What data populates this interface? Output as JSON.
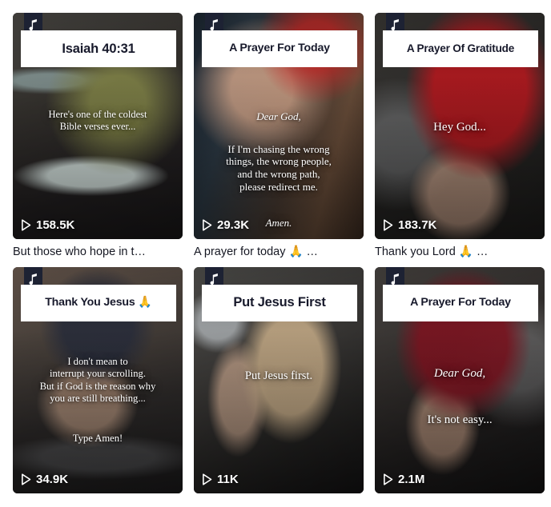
{
  "feed": {
    "videos": [
      {
        "id": "video-1",
        "music_icon": "music-note-icon",
        "title": "Isaiah 40:31",
        "overlay_text": "Here's one of the coldest\nBible verses ever...",
        "play_icon": "play-icon",
        "play_count": "158.5K",
        "caption": "But those who hope in t…"
      },
      {
        "id": "video-2",
        "music_icon": "music-note-icon",
        "title": "A Prayer For Today",
        "overlay_italic_top": "Dear God,",
        "overlay_text": "If I'm chasing the wrong\nthings, the wrong people,\nand the wrong path,\nplease redirect me.",
        "overlay_italic_bottom": "Amen.",
        "play_icon": "play-icon",
        "play_count": "29.3K",
        "caption": "A prayer for today 🙏 …"
      },
      {
        "id": "video-3",
        "music_icon": "music-note-icon",
        "title": "A Prayer Of Gratitude",
        "overlay_text": "Hey God...",
        "play_icon": "play-icon",
        "play_count": "183.7K",
        "caption": "Thank you Lord 🙏 …"
      },
      {
        "id": "video-4",
        "music_icon": "music-note-icon",
        "title": "Thank You Jesus 🙏",
        "overlay_text": "I don't mean to\ninterrupt your scrolling.\nBut if God is the reason why\nyou are still breathing...",
        "overlay_italic_bottom": "Type Amen!",
        "play_icon": "play-icon",
        "play_count": "34.9K",
        "caption": ""
      },
      {
        "id": "video-5",
        "music_icon": "music-note-icon",
        "title": "Put Jesus First",
        "overlay_text": "Put Jesus first.",
        "play_icon": "play-icon",
        "play_count": "11K",
        "caption": ""
      },
      {
        "id": "video-6",
        "music_icon": "music-note-icon",
        "title": "A Prayer For Today",
        "overlay_italic_top": "Dear God,",
        "overlay_text": "It's not easy...",
        "play_icon": "play-icon",
        "play_count": "2.1M",
        "caption": ""
      }
    ]
  },
  "colors": {
    "page_background": "#ffffff",
    "caption_text": "#161823",
    "banner_background": "#ffffff",
    "banner_text": "#17192b",
    "badge_background": "#1d2233",
    "overlay_text": "#ffffff"
  }
}
